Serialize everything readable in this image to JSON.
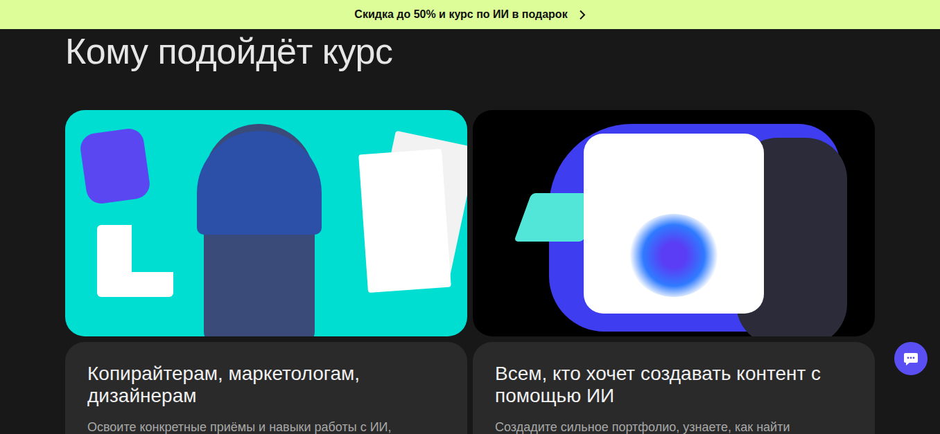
{
  "banner": {
    "text": "Скидка до 50% и курс по ИИ в подарок"
  },
  "section": {
    "title": "Кому подойдёт курс"
  },
  "cards": [
    {
      "kind": "robot",
      "title": "Копирайтерам, маркетологам, дизайнерам",
      "text": "Освоите конкретные приёмы и навыки работы с ИИ,"
    },
    {
      "kind": "chat",
      "title": "Всем, кто хочет создавать контент с помощью ИИ",
      "text": "Создадите сильное портфолио, узнаете, как найти"
    }
  ]
}
